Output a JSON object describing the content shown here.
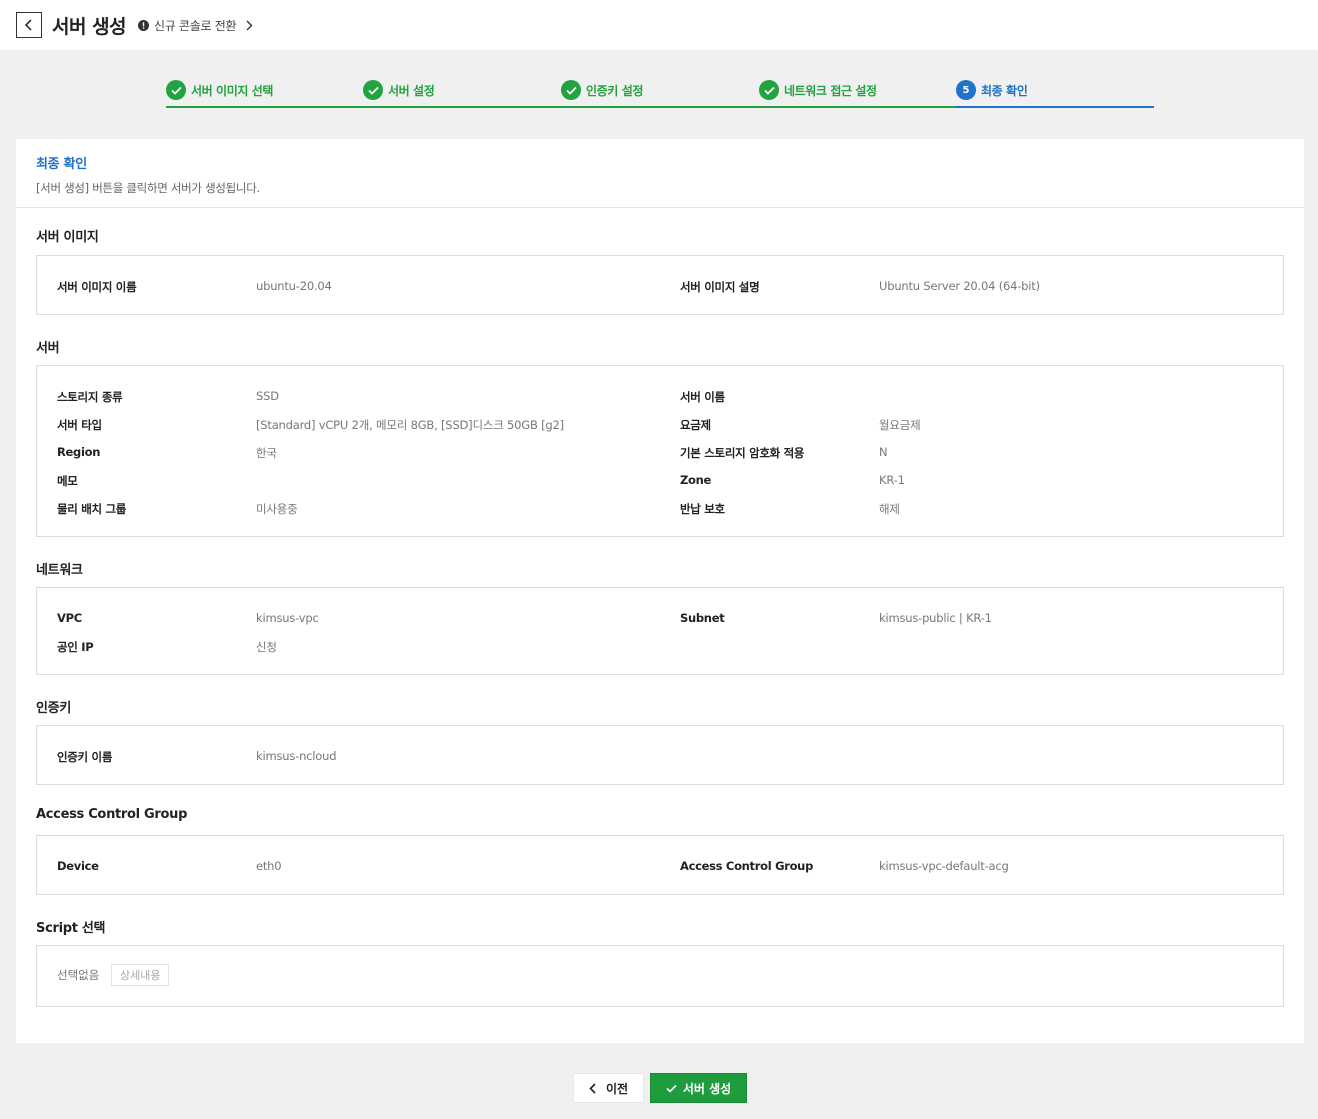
{
  "header": {
    "title": "서버 생성",
    "switch_console": "신규 콘솔로 전환"
  },
  "steps": [
    {
      "label": "서버 이미지 선택",
      "state": "done"
    },
    {
      "label": "서버 설정",
      "state": "done"
    },
    {
      "label": "인증키 설정",
      "state": "done"
    },
    {
      "label": "네트워크 접근 설정",
      "state": "done"
    },
    {
      "label": "최종 확인",
      "state": "current",
      "number": "5"
    }
  ],
  "colors": {
    "done": "#22a33f",
    "current": "#1f73c8",
    "primary_button": "#1f9c3d"
  },
  "panel": {
    "title": "최종 확인",
    "description": "[서버 생성] 버튼을 클릭하면 서버가 생성됩니다."
  },
  "server_image": {
    "title": "서버 이미지",
    "name_label": "서버 이미지 이름",
    "name_value": "ubuntu-20.04",
    "desc_label": "서버 이미지 설명",
    "desc_value": "Ubuntu Server 20.04 (64-bit)"
  },
  "server": {
    "title": "서버",
    "storage_type_label": "스토리지 종류",
    "storage_type_value": "SSD",
    "server_name_label": "서버 이름",
    "server_name_value": "",
    "server_type_label": "서버 타입",
    "server_type_value": "[Standard] vCPU 2개, 메모리 8GB, [SSD]디스크 50GB [g2]",
    "plan_label": "요금제",
    "plan_value": "월요금제",
    "region_label": "Region",
    "region_value": "한국",
    "encryption_label": "기본 스토리지 암호화 적용",
    "encryption_value": "N",
    "memo_label": "메모",
    "memo_value": "",
    "zone_label": "Zone",
    "zone_value": "KR-1",
    "placement_label": "물리 배치 그룹",
    "placement_value": "미사용중",
    "return_protect_label": "반납 보호",
    "return_protect_value": "해제"
  },
  "network": {
    "title": "네트워크",
    "vpc_label": "VPC",
    "vpc_value": "kimsus-vpc",
    "subnet_label": "Subnet",
    "subnet_value": "kimsus-public | KR-1",
    "public_ip_label": "공인 IP",
    "public_ip_value": "신청"
  },
  "auth_key": {
    "title": "인증키",
    "name_label": "인증키 이름",
    "name_value": "kimsus-ncloud"
  },
  "acg": {
    "title": "Access Control Group",
    "device_label": "Device",
    "device_value": "eth0",
    "acg_label": "Access Control Group",
    "acg_value": "kimsus-vpc-default-acg"
  },
  "script": {
    "title": "Script 선택",
    "none": "선택없음",
    "detail_button": "상세내용"
  },
  "footer": {
    "prev_button": "이전",
    "create_button": "서버 생성"
  }
}
